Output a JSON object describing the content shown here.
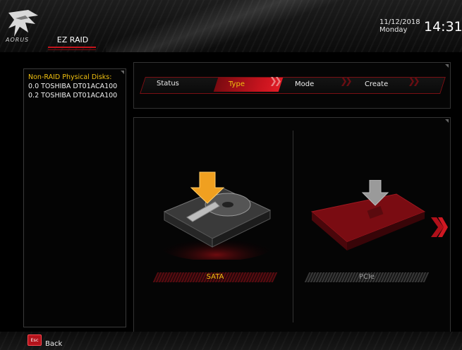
{
  "header": {
    "logo_text": "AORUS",
    "tab_label": "EZ RAID",
    "date": "11/12/2018",
    "weekday": "Monday",
    "time": "14:31"
  },
  "left_panel": {
    "title": "Non-RAID Physical Disks:",
    "disks": [
      "0.0  TOSHIBA DT01ACA100",
      "0.2  TOSHIBA DT01ACA100"
    ]
  },
  "steps": {
    "items": [
      {
        "label": "Status",
        "active": false
      },
      {
        "label": "Type",
        "active": true
      },
      {
        "label": "Mode",
        "active": false
      },
      {
        "label": "Create",
        "active": false
      }
    ]
  },
  "options": {
    "sata_label": "SATA",
    "pcie_label": "PCIe"
  },
  "footer": {
    "esc_key": "Esc",
    "back_label": "Back"
  },
  "colors": {
    "accent_red": "#c8141e",
    "highlight_yellow": "#f0c010",
    "sata_label_color": "#f0c010",
    "pcie_label_color": "#9a9a9a"
  }
}
